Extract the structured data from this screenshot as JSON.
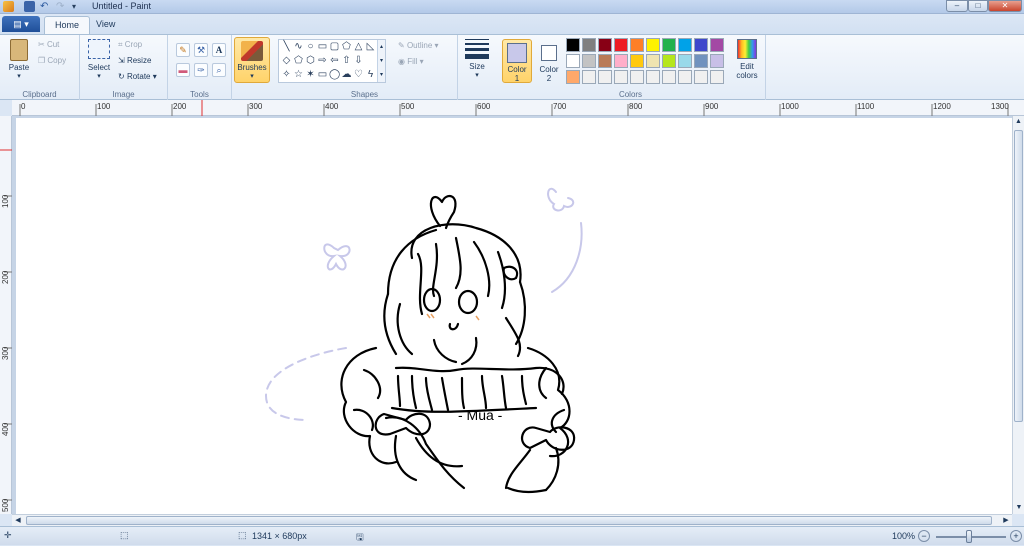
{
  "window": {
    "title": "Untitled - Paint"
  },
  "tabs": [
    {
      "label": "Home"
    },
    {
      "label": "View"
    }
  ],
  "clipboard": {
    "group": "Clipboard",
    "paste": "Paste",
    "cut": "Cut",
    "copy": "Copy"
  },
  "image": {
    "group": "Image",
    "select": "Select",
    "crop": "Crop",
    "resize": "Resize",
    "rotate": "Rotate"
  },
  "tools": {
    "group": "Tools",
    "text_glyph": "A"
  },
  "brushes": {
    "label": "Brushes"
  },
  "shapes": {
    "group": "Shapes",
    "outline": "Outline",
    "fill": "Fill"
  },
  "size": {
    "label": "Size"
  },
  "colors": {
    "group": "Colors",
    "color1_label": "Color",
    "color1_num": "1",
    "color1_value": "#c8c8ea",
    "color2_label": "Color",
    "color2_num": "2",
    "color2_value": "#ffffff",
    "edit_label": "Edit",
    "edit_label2": "colors",
    "palette_row1": [
      "#000000",
      "#7f7f7f",
      "#880015",
      "#ed1c24",
      "#ff7f27",
      "#fff200",
      "#22b14c",
      "#00a2e8",
      "#3f48cc",
      "#a349a4"
    ],
    "palette_row2": [
      "#ffffff",
      "#c3c3c3",
      "#b97a57",
      "#ffaec9",
      "#ffc90e",
      "#efe4b0",
      "#b5e61d",
      "#99d9ea",
      "#7092be",
      "#c8bfe7"
    ],
    "palette_row3": [
      "#ffa86a",
      "#f0f0f0",
      "#f0f0f0",
      "#f0f0f0",
      "#f0f0f0",
      "#f0f0f0",
      "#f0f0f0",
      "#f0f0f0",
      "#f0f0f0",
      "#f0f0f0"
    ]
  },
  "ruler": {
    "top": [
      "0",
      "100",
      "200",
      "300",
      "400",
      "500",
      "600",
      "700",
      "800",
      "900",
      "1000",
      "1100",
      "1200",
      "1300"
    ],
    "left": [
      "100",
      "200",
      "300",
      "400",
      "500"
    ]
  },
  "drawing": {
    "signature": "- Mua -"
  },
  "status": {
    "dimensions": "1341 × 680px",
    "zoom": "100%"
  }
}
